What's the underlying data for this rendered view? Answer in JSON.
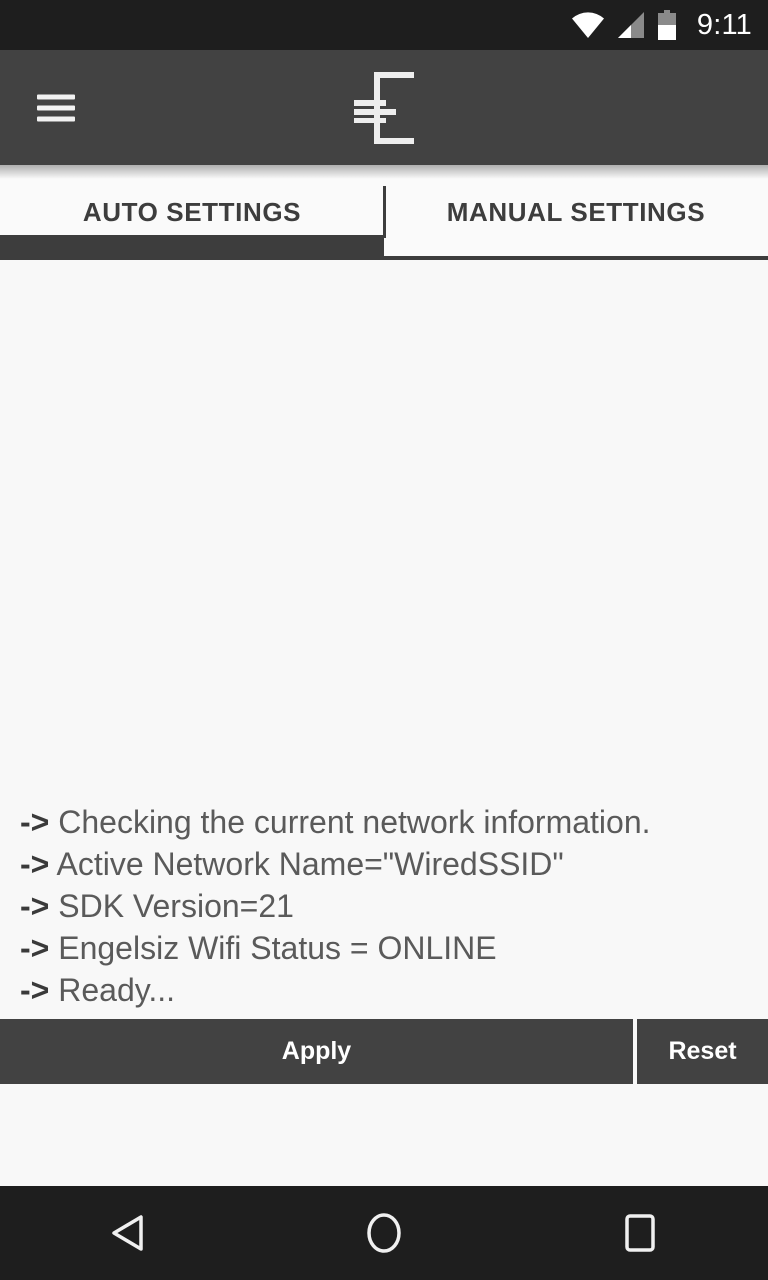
{
  "status_bar": {
    "clock": "9:11",
    "icons": [
      "wifi-icon",
      "cell-signal-icon",
      "battery-icon"
    ],
    "background": "#1e1e1e"
  },
  "app_bar": {
    "menu_icon": "hamburger-menu-icon",
    "logo_icon": "app-logo-e-icon",
    "background": "#424242"
  },
  "tabs": {
    "items": [
      {
        "label": "AUTO SETTINGS",
        "active": true
      },
      {
        "label": "MANUAL SETTINGS",
        "active": false
      }
    ],
    "indicator_color": "#3d3d3d"
  },
  "log": {
    "lines": [
      {
        "arrow": "->",
        "text": "Checking the current network information."
      },
      {
        "arrow": "->",
        "text": "Active Network Name=\"WiredSSID\""
      },
      {
        "arrow": "->",
        "text": "SDK Version=21"
      },
      {
        "arrow": "->",
        "text": "Engelsiz Wifi Status = ONLINE"
      },
      {
        "arrow": "->",
        "text": "Ready..."
      }
    ],
    "text_color": "#5a5a5a"
  },
  "actions": {
    "apply_label": "Apply",
    "reset_label": "Reset",
    "button_color": "#424242"
  },
  "nav_bar": {
    "back_icon": "back-triangle-icon",
    "home_icon": "home-circle-icon",
    "recents_icon": "recents-square-icon",
    "background": "#1e1e1e"
  }
}
